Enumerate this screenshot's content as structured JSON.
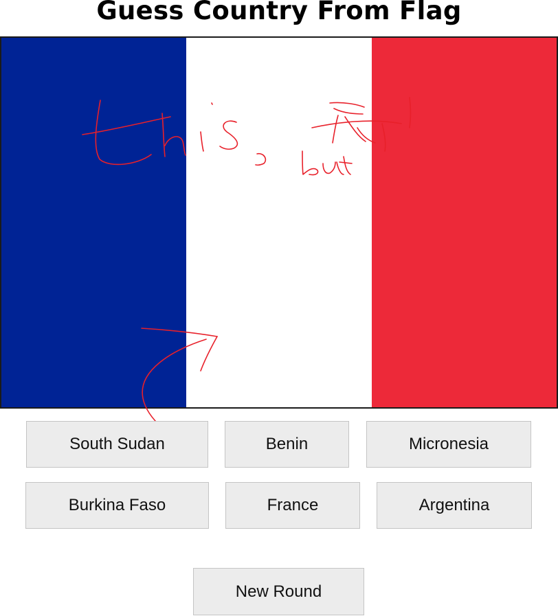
{
  "title": "Guess Country From Flag",
  "flag": {
    "stripes": [
      {
        "name": "blue",
        "color": "#002395"
      },
      {
        "name": "white",
        "color": "#ffffff"
      },
      {
        "name": "red",
        "color": "#ed2939"
      }
    ]
  },
  "annotation": {
    "color": "#e8202a",
    "words": [
      "this,",
      "but"
    ]
  },
  "options": [
    "South Sudan",
    "Benin",
    "Micronesia",
    "Burkina Faso",
    "France",
    "Argentina"
  ],
  "new_round_label": "New Round",
  "colors": {
    "button_bg": "#ececec",
    "button_border": "#c4c4c4"
  }
}
